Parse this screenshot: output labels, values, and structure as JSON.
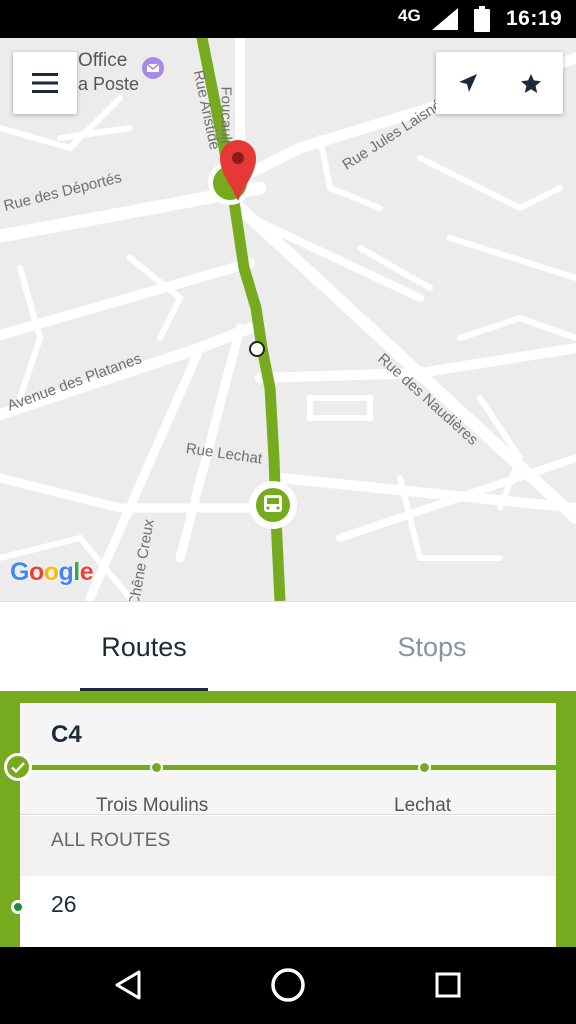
{
  "status_bar": {
    "network": "4G",
    "time": "16:19",
    "signal_icon": "cell-signal-icon",
    "battery_icon": "battery-icon"
  },
  "map": {
    "street_labels": {
      "aristide": "Rue Aristide",
      "foucault": "Foucault",
      "deportes": "Rue des Déportés",
      "jules": "Rue Jules Laisné",
      "platanes": "Avenue des Platanes",
      "naudieres": "Rue des Naudières",
      "lechat": "Rue Lechat",
      "chene": "Chêne Creux"
    },
    "poi": {
      "office": "Office",
      "poste": "a Poste"
    },
    "google_logo": "Google",
    "colors": {
      "route": "#77ab1f",
      "pin": "#e53935",
      "background": "#ececec"
    },
    "icons": [
      "menu-icon",
      "navigation-arrow-icon",
      "star-icon",
      "location-pin-icon",
      "bus-icon"
    ]
  },
  "tabs": {
    "routes": "Routes",
    "stops": "Stops",
    "selected": "Routes"
  },
  "route_panel": {
    "route_name": "C4",
    "stops": [
      "Trois Moulins",
      "Lechat"
    ],
    "section_title": "ALL ROUTES",
    "items": [
      "26"
    ],
    "accent": "#77ab1f"
  },
  "nav_bar": {
    "icons": [
      "back-icon",
      "home-icon",
      "recents-icon"
    ]
  }
}
